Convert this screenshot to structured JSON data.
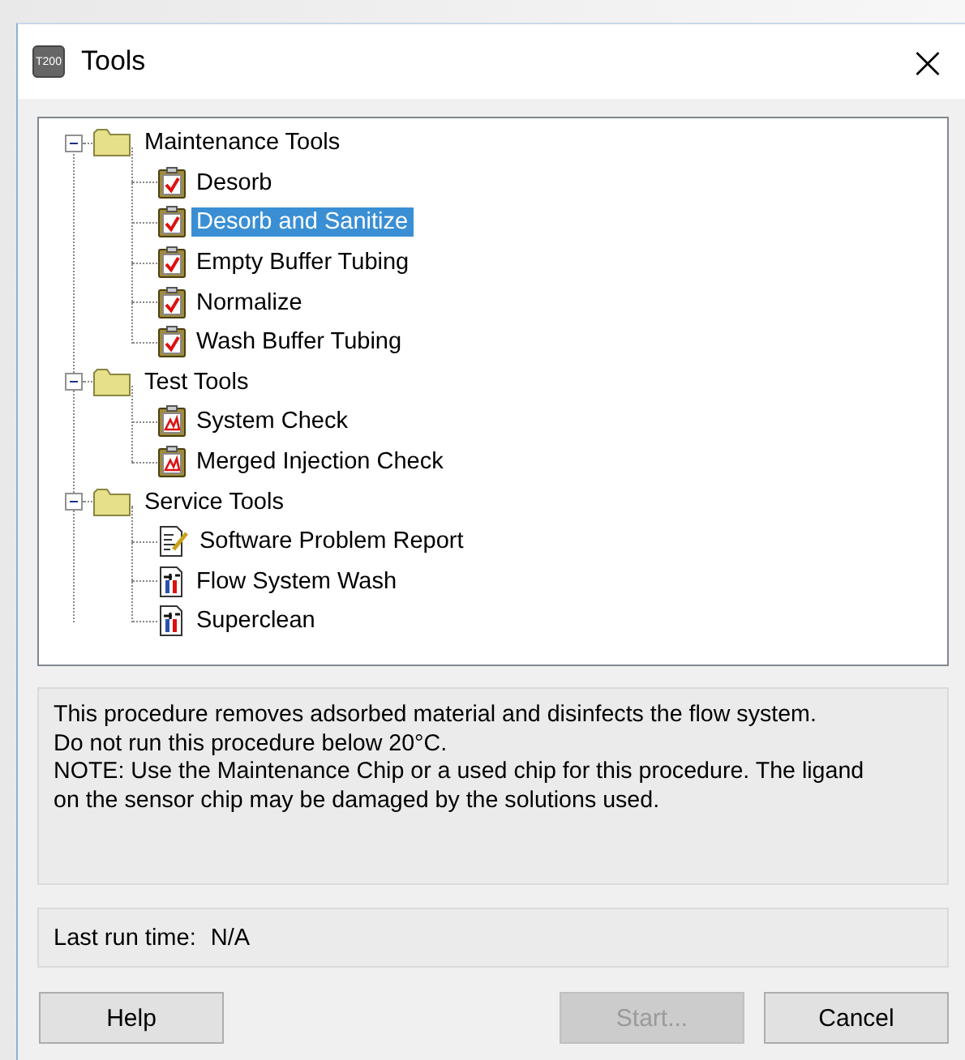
{
  "window": {
    "icon_text": "T200",
    "title": "Tools",
    "close": "×"
  },
  "tree": [
    {
      "label": "Maintenance Tools",
      "kind": "folder",
      "expanded": true,
      "selected": false,
      "children": [
        {
          "label": "Desorb",
          "kind": "procedure",
          "selected": false
        },
        {
          "label": "Desorb and Sanitize",
          "kind": "procedure",
          "selected": true
        },
        {
          "label": "Empty Buffer Tubing",
          "kind": "procedure",
          "selected": false
        },
        {
          "label": "Normalize",
          "kind": "procedure",
          "selected": false
        },
        {
          "label": "Wash Buffer Tubing",
          "kind": "procedure",
          "selected": false
        }
      ]
    },
    {
      "label": "Test Tools",
      "kind": "folder",
      "expanded": true,
      "selected": false,
      "children": [
        {
          "label": "System Check",
          "kind": "test",
          "selected": false
        },
        {
          "label": "Merged Injection Check",
          "kind": "test",
          "selected": false
        }
      ]
    },
    {
      "label": "Service Tools",
      "kind": "folder",
      "expanded": true,
      "selected": false,
      "children": [
        {
          "label": "Software Problem Report",
          "kind": "report",
          "selected": false
        },
        {
          "label": "Flow System Wash",
          "kind": "service",
          "selected": false
        },
        {
          "label": "Superclean",
          "kind": "service",
          "selected": false
        }
      ]
    }
  ],
  "description": [
    "This procedure removes adsorbed material and disinfects the flow system.",
    "Do not run this procedure below 20°C.",
    "NOTE: Use the Maintenance Chip or a used chip for this procedure. The ligand on the sensor chip may be damaged by the solutions used."
  ],
  "last_run": {
    "label": "Last run time:",
    "value": "N/A"
  },
  "buttons": [
    {
      "label": "Help",
      "disabled": false
    },
    {
      "label": "Start...",
      "disabled": true
    },
    {
      "label": "Cancel",
      "disabled": false
    }
  ]
}
